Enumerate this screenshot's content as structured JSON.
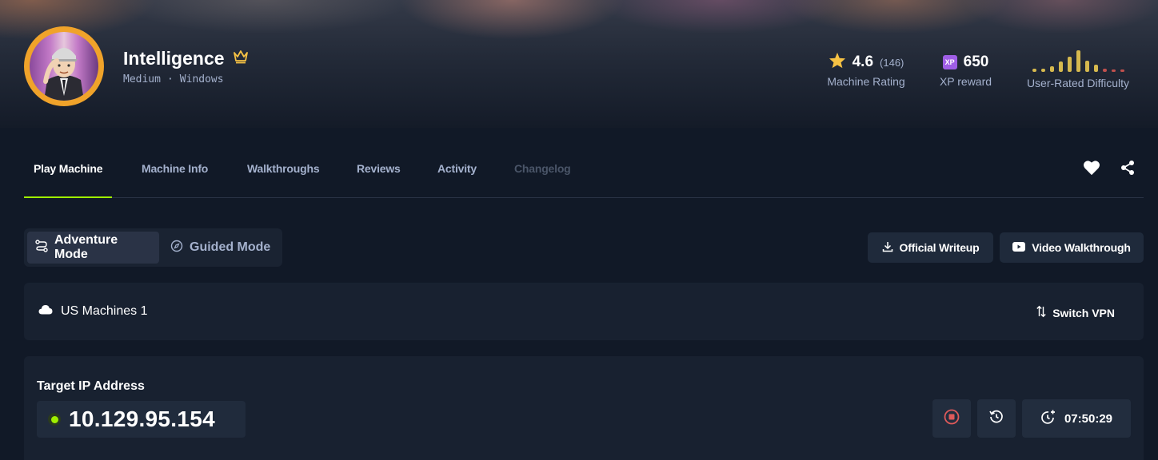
{
  "machine": {
    "name": "Intelligence",
    "difficulty": "Medium",
    "separator": "·",
    "os": "Windows"
  },
  "stats": {
    "rating_value": "4.6",
    "rating_count": "(146)",
    "rating_label": "Machine Rating",
    "xp_badge": "XP",
    "xp_value": "650",
    "xp_label": "XP reward",
    "difficulty_label": "User-Rated Difficulty"
  },
  "difficulty_chart": {
    "values": [
      0.12,
      0.12,
      0.22,
      0.4,
      0.6,
      0.85,
      0.45,
      0.28,
      0.12,
      0.08,
      0.08
    ]
  },
  "tabs": [
    {
      "label": "Play Machine",
      "state": "active"
    },
    {
      "label": "Machine Info",
      "state": "normal"
    },
    {
      "label": "Walkthroughs",
      "state": "normal"
    },
    {
      "label": "Reviews",
      "state": "normal"
    },
    {
      "label": "Activity",
      "state": "normal"
    },
    {
      "label": "Changelog",
      "state": "disabled"
    }
  ],
  "modes": {
    "adventure": "Adventure Mode",
    "guided": "Guided Mode"
  },
  "actions": {
    "writeup": "Official Writeup",
    "video": "Video Walkthrough"
  },
  "vpn": {
    "server": "US Machines 1",
    "switch_label": "Switch VPN"
  },
  "target": {
    "label": "Target IP Address",
    "ip": "10.129.95.154",
    "timer": "07:50:29"
  },
  "colors": {
    "accent": "#9fef00",
    "star": "#f6c244",
    "xp": "#9f5ee6",
    "stop": "#e05a5a",
    "avatar_ring": "#f0a32a"
  },
  "icons": {
    "crown": "crown-icon",
    "star": "star-icon",
    "heart": "heart-icon",
    "share": "share-icon",
    "route": "route-icon",
    "compass": "compass-icon",
    "download": "download-icon",
    "youtube": "youtube-icon",
    "cloud": "cloud-icon",
    "swap": "swap-icon",
    "stop": "stop-icon",
    "reset": "reset-icon",
    "extend": "extend-timer-icon"
  }
}
